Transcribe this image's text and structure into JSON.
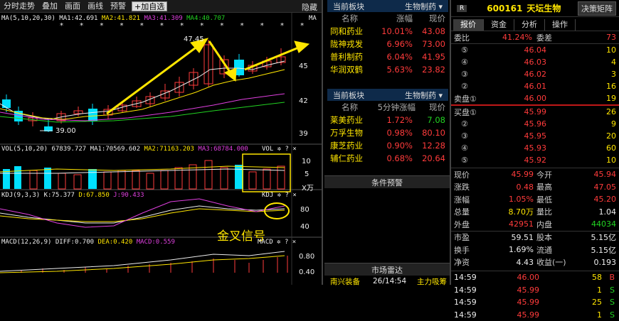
{
  "toolbar": {
    "items": [
      "分时走势",
      "叠加",
      "画面",
      "画线",
      "预警"
    ],
    "add_watch": "+加自选",
    "hide": "隐藏"
  },
  "kline": {
    "ma_legend": {
      "name": "MA(5,10,20,30)",
      "ma1": "MA1:42.691",
      "ma2": "MA2:41.821",
      "ma3": "MA3:41.309",
      "ma4": "MA4:40.707",
      "tag": "MA"
    },
    "high_label": "47.45",
    "low_label": "39.00",
    "price_ticks": [
      "45",
      "42",
      "39"
    ],
    "stars": "* * * * * * * * * * * * *"
  },
  "vol": {
    "legend": "VOL(5,10,20)",
    "vol": "67839.727",
    "ma1": "MA1:70569.602",
    "ma2": "MA2:71163.203",
    "ma3": "MA3:68784.000",
    "tag": "VOL",
    "ticks": [
      "10",
      "5"
    ],
    "unit": "X万"
  },
  "kdj": {
    "legend": "KDJ(9,3,3)",
    "k": "K:75.377",
    "d": "D:67.850",
    "j": "J:90.433",
    "tag": "KDJ",
    "ticks": [
      "80",
      "40"
    ],
    "annotation": "金叉信号"
  },
  "macd": {
    "legend": "MACD(12,26,9)",
    "diff": "DIFF:0.700",
    "dea": "DEA:0.420",
    "macd": "MACD:0.559",
    "tag": "MACD",
    "ticks": [
      "0.80",
      "0.40"
    ]
  },
  "sector1": {
    "header": "当前板块",
    "sector_name": "生物制药",
    "cols": [
      "名称",
      "涨幅",
      "现价"
    ],
    "rows": [
      {
        "name": "同和药业",
        "pct": "10.01%",
        "price": "43.08"
      },
      {
        "name": "陇神戎发",
        "pct": "6.96%",
        "price": "73.00"
      },
      {
        "name": "普利制药",
        "pct": "6.04%",
        "price": "41.95"
      },
      {
        "name": "华润双鹤",
        "pct": "5.63%",
        "price": "23.82"
      }
    ]
  },
  "sector2": {
    "header": "当前板块",
    "sector_name": "生物制药",
    "cols": [
      "名称",
      "5分钟涨幅",
      "现价"
    ],
    "rows": [
      {
        "name": "莱美药业",
        "pct": "1.72%",
        "price": "7.08"
      },
      {
        "name": "万孚生物",
        "pct": "0.98%",
        "price": "80.10"
      },
      {
        "name": "康芝药业",
        "pct": "0.90%",
        "price": "12.28"
      },
      {
        "name": "辅仁药业",
        "pct": "0.68%",
        "price": "20.64"
      }
    ]
  },
  "alert_header": "条件预警",
  "radar": {
    "header": "市场雷达",
    "row": {
      "name": "南兴装备",
      "time": "26/14:54",
      "event": "主力吸筹"
    }
  },
  "quote": {
    "badge": "R",
    "code": "600161",
    "name": "天坛生物",
    "decision_btn": "决策矩阵",
    "tabs": [
      "报价",
      "资金",
      "分析",
      "操作"
    ],
    "weibi_label": "委比",
    "weibi": "41.24%",
    "weicha_label": "委差",
    "weicha": "73",
    "sell": [
      {
        "label": "⑤",
        "price": "46.04",
        "vol": "10"
      },
      {
        "label": "④",
        "price": "46.03",
        "vol": "4"
      },
      {
        "label": "③",
        "price": "46.02",
        "vol": "3"
      },
      {
        "label": "②",
        "price": "46.01",
        "vol": "16"
      },
      {
        "label": "卖盘①",
        "price": "46.00",
        "vol": "19"
      }
    ],
    "buy": [
      {
        "label": "买盘①",
        "price": "45.99",
        "vol": "26"
      },
      {
        "label": "②",
        "price": "45.96",
        "vol": "9"
      },
      {
        "label": "③",
        "price": "45.95",
        "vol": "20"
      },
      {
        "label": "④",
        "price": "45.93",
        "vol": "60"
      },
      {
        "label": "⑤",
        "price": "45.92",
        "vol": "10"
      }
    ],
    "stats": [
      {
        "l1": "现价",
        "v1": "45.99",
        "l2": "今开",
        "v2": "45.94"
      },
      {
        "l1": "涨跌",
        "v1": "0.48",
        "l2": "最高",
        "v2": "47.05"
      },
      {
        "l1": "涨幅",
        "v1": "1.05%",
        "l2": "最低",
        "v2": "45.20"
      },
      {
        "l1": "总量",
        "v1": "8.70万",
        "l2": "量比",
        "v2": "1.04"
      },
      {
        "l1": "外盘",
        "v1": "42951",
        "l2": "内盘",
        "v2": "44034"
      }
    ],
    "stats2": [
      {
        "l1": "市盈",
        "v1": "59.51",
        "l2": "股本",
        "v2": "5.15亿"
      },
      {
        "l1": "换手",
        "v1": "1.69%",
        "l2": "流通",
        "v2": "5.15亿"
      },
      {
        "l1": "净资",
        "v1": "4.43",
        "l2": "收益(一)",
        "v2": "0.193"
      }
    ],
    "ticks": [
      {
        "time": "14:59",
        "price": "46.00",
        "vol": "58",
        "side": "B"
      },
      {
        "time": "14:59",
        "price": "45.99",
        "vol": "1",
        "side": "S"
      },
      {
        "time": "14:59",
        "price": "45.99",
        "vol": "25",
        "side": "S"
      },
      {
        "time": "14:59",
        "price": "45.99",
        "vol": "1",
        "side": "S"
      }
    ]
  },
  "colors": {
    "up": "#ff3b3b",
    "down": "#22d422",
    "accent": "#ffe600",
    "cyan": "#4fd2ff",
    "kline_up": "#ff3b3b",
    "kline_down": "#00e0ff"
  }
}
